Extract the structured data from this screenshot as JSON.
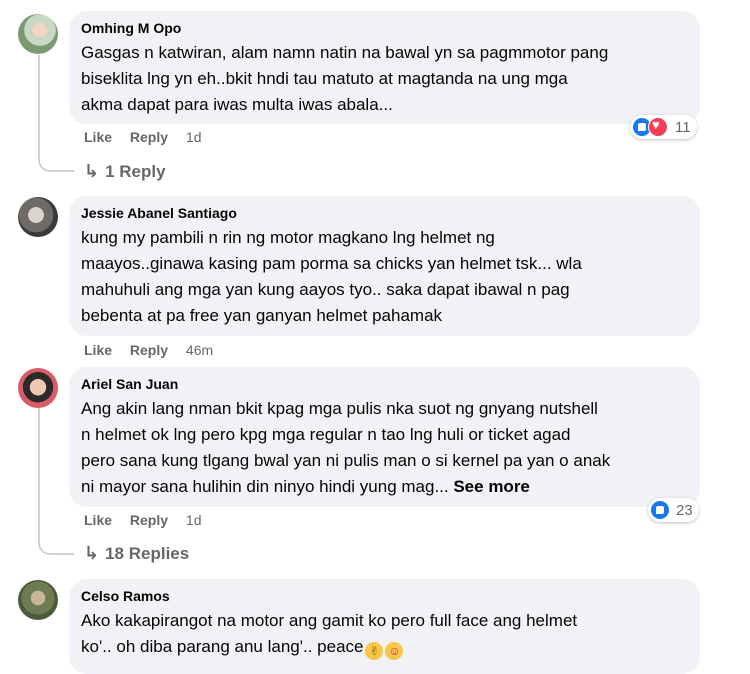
{
  "comments": [
    {
      "author": "Omhing M Opo",
      "lines": [
        "Gasgas n katwiran, alam namn natin na bawal yn sa pagmmotor pang",
        "biseklita lng yn eh..bkit hndi tau matuto at magtanda na ung mga",
        "akma dapat para iwas multa iwas abala..."
      ],
      "like_label": "Like",
      "reply_label": "Reply",
      "time": "1d",
      "reaction_count": "11",
      "reaction_icons": [
        "like-icon",
        "love-icon"
      ],
      "replies_label": "1 Reply"
    },
    {
      "author": "Jessie Abanel Santiago",
      "lines": [
        "kung my pambili n rin ng motor magkano lng helmet ng",
        "maayos..ginawa kasing pam porma sa chicks yan helmet tsk... wla",
        "mahuhuli ang mga yan kung aayos tyo.. saka dapat ibawal n pag",
        "bebenta at pa free yan ganyan helmet pahamak"
      ],
      "like_label": "Like",
      "reply_label": "Reply",
      "time": "46m"
    },
    {
      "author": "Ariel San Juan",
      "lines": [
        "Ang akin lang nman bkit kpag mga pulis nka suot ng gnyang nutshell",
        "n helmet ok lng pero kpg mga regular n tao lng huli or ticket agad",
        "pero sana kung tlgang bwal yan ni pulis man o si kernel pa yan o anak",
        "ni mayor sana hulihin din ninyo hindi yung mag..."
      ],
      "see_more": "See more",
      "like_label": "Like",
      "reply_label": "Reply",
      "time": "1d",
      "reaction_count": "23",
      "reaction_icons": [
        "like-icon"
      ],
      "replies_label": "18 Replies"
    },
    {
      "author": "Celso Ramos",
      "lines": [
        "Ako kakapirangot na motor ang gamit ko pero full face ang helmet",
        "ko'.. oh diba parang anu lang'.. peace"
      ],
      "trailing_emojis": [
        "victory-hand-emoji",
        "rofl-emoji"
      ]
    }
  ],
  "colors": {
    "bubble_bg": "#f0f2f5",
    "secondary_text": "#65676b",
    "like_blue": "#1877f2",
    "love_red": "#f33e58"
  }
}
